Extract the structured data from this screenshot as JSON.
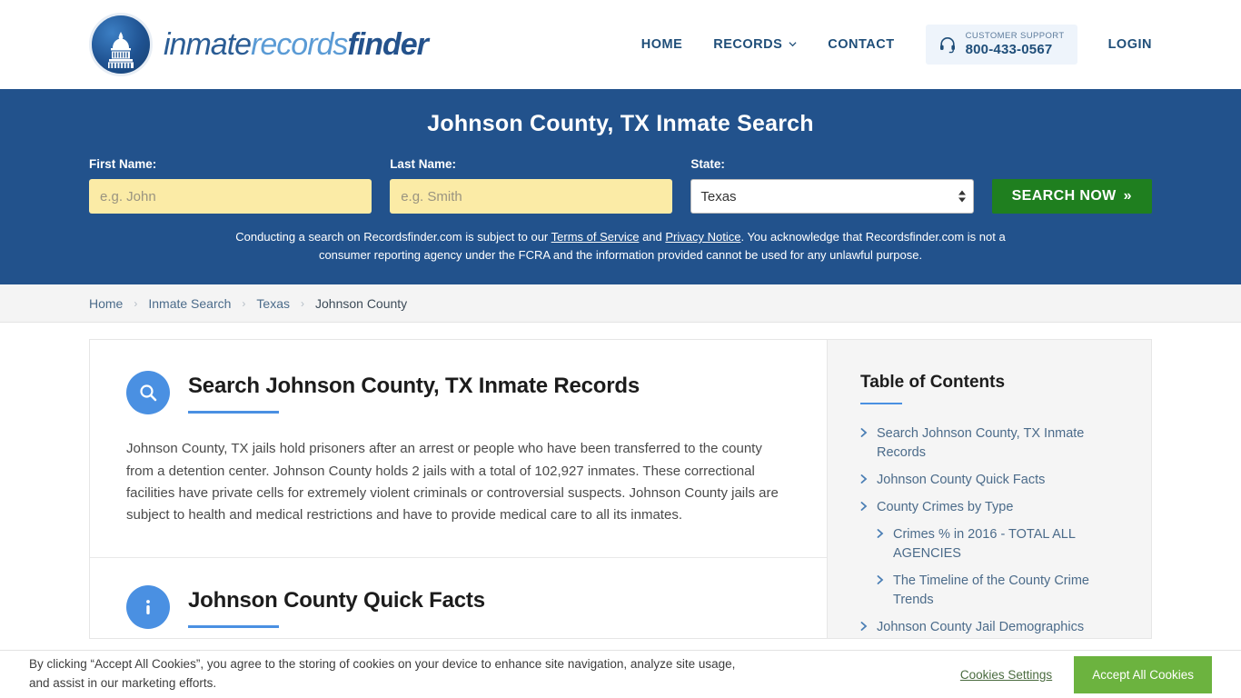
{
  "header": {
    "logo": {
      "icon": "capitol-dome-icon",
      "part1": "inmate",
      "part2": "records",
      "part3": "finder"
    },
    "nav": [
      {
        "label": "HOME",
        "has_chevron": false
      },
      {
        "label": "RECORDS",
        "has_chevron": true
      },
      {
        "label": "CONTACT",
        "has_chevron": false
      }
    ],
    "support": {
      "icon": "headset-icon",
      "label": "CUSTOMER SUPPORT",
      "phone": "800-433-0567"
    },
    "login_label": "LOGIN"
  },
  "hero": {
    "title": "Johnson County, TX Inmate Search",
    "fields": {
      "first_name": {
        "label": "First Name:",
        "value": "",
        "placeholder": "e.g. John"
      },
      "last_name": {
        "label": "Last Name:",
        "value": "",
        "placeholder": "e.g. Smith"
      },
      "state": {
        "label": "State:",
        "value": "Texas"
      }
    },
    "search_button": "SEARCH NOW",
    "search_button_arrow": "»",
    "disclaimer": {
      "part1": "Conducting a search on Recordsfinder.com is subject to our ",
      "link1": "Terms of Service",
      "part2": " and ",
      "link2": "Privacy Notice",
      "part3": ". You acknowledge that Recordsfinder.com is not a consumer reporting agency under the FCRA and the information provided cannot be used for any unlawful purpose."
    }
  },
  "breadcrumb": {
    "separator": "›",
    "items": [
      {
        "label": "Home"
      },
      {
        "label": "Inmate Search"
      },
      {
        "label": "Texas"
      },
      {
        "label": "Johnson County"
      }
    ]
  },
  "main": {
    "section1": {
      "icon": "search-magnifier-icon",
      "title": "Search Johnson County, TX Inmate Records",
      "body": "Johnson County, TX jails hold prisoners after an arrest or people who have been transferred to the county from a detention center. Johnson County holds 2 jails with a total of 102,927 inmates. These correctional facilities have private cells for extremely violent criminals or controversial suspects. Johnson County jails are subject to health and medical restrictions and have to provide medical care to all its inmates."
    },
    "section2": {
      "icon": "info-circle-icon",
      "title": "Johnson County Quick Facts"
    }
  },
  "sidebar": {
    "title": "Table of Contents",
    "items": [
      {
        "label": "Search Johnson County, TX Inmate Records",
        "level": 1
      },
      {
        "label": "Johnson County Quick Facts",
        "level": 1
      },
      {
        "label": "County Crimes by Type",
        "level": 1
      },
      {
        "label": "Crimes % in 2016 - TOTAL ALL AGENCIES",
        "level": 2
      },
      {
        "label": "The Timeline of the County Crime Trends",
        "level": 2
      },
      {
        "label": "Johnson County Jail Demographics",
        "level": 1
      }
    ]
  },
  "cookie_banner": {
    "text": "By clicking “Accept All Cookies”, you agree to the storing of cookies on your device to enhance site navigation, analyze site usage, and assist in our marketing efforts.",
    "settings_label": "Cookies Settings",
    "accept_label": "Accept All Cookies"
  },
  "colors": {
    "hero_blue": "#22528c",
    "accent_blue": "#4a90e2",
    "search_green": "#1f7f1f",
    "cookie_green": "#6cb33f",
    "input_yellow": "#fbeba6"
  }
}
